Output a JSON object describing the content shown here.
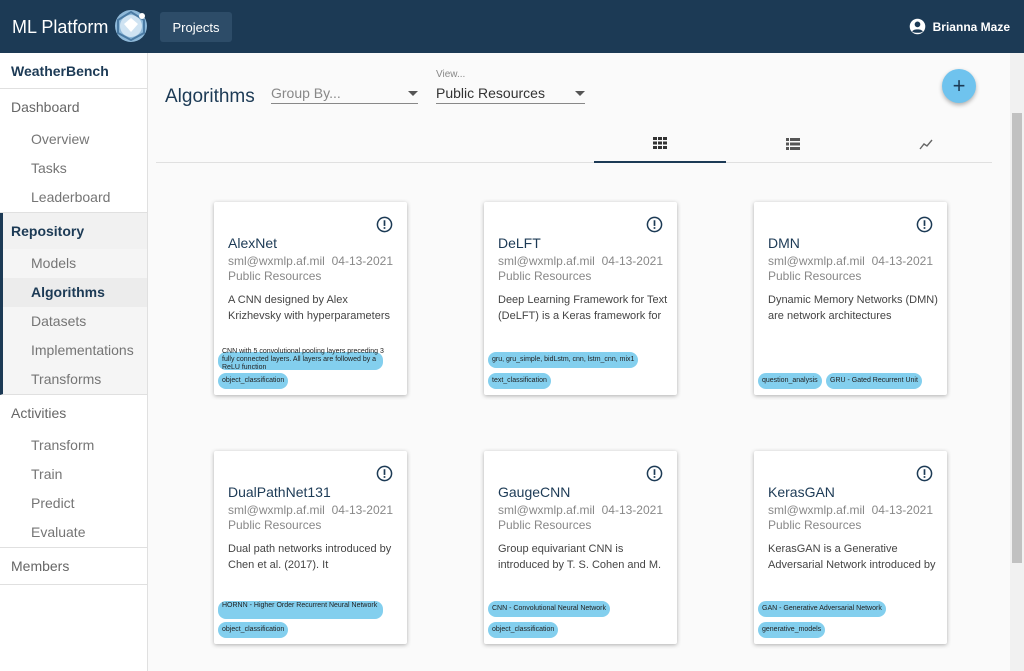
{
  "header": {
    "brand": "ML Platform",
    "projects_label": "Projects",
    "user_name": "Brianna Maze"
  },
  "sidebar": {
    "project": "WeatherBench",
    "dashboard": {
      "label": "Dashboard",
      "items": [
        "Overview",
        "Tasks",
        "Leaderboard"
      ]
    },
    "repository": {
      "label": "Repository",
      "items": [
        "Models",
        "Algorithms",
        "Datasets",
        "Implementations",
        "Transforms"
      ],
      "active": "Algorithms"
    },
    "activities": {
      "label": "Activities",
      "items": [
        "Transform",
        "Train",
        "Predict",
        "Evaluate"
      ]
    },
    "members": "Members"
  },
  "main": {
    "title": "Algorithms",
    "group_by_placeholder": "Group By...",
    "view_label": "View...",
    "view_value": "Public Resources",
    "add_symbol": "+",
    "active_tab": "grid"
  },
  "colors": {
    "primary": "#1c3a55",
    "accent": "#6fc3ee",
    "tag": "#83cfee"
  },
  "cards": [
    {
      "name": "AlexNet",
      "email": "sml@wxmlp.af.mil",
      "date": "04-13-2021",
      "visibility": "Public Resources",
      "description": "A CNN designed by Alex Krizhevsky with hyperparameters",
      "overflow_text": "CNN with 5 convolutional pooling layers preceding 3 fully connected layers. All layers are followed by a ReLU function",
      "tags": [
        "object_classification"
      ]
    },
    {
      "name": "DeLFT",
      "email": "sml@wxmlp.af.mil",
      "date": "04-13-2021",
      "visibility": "Public Resources",
      "description": "Deep Learning Framework for Text (DeLFT) is a Keras framework for",
      "tags": [
        "gru, gru_simple, bidLstm, cnn, lstm_cnn, mix1",
        "text_classification"
      ]
    },
    {
      "name": "DMN",
      "email": "sml@wxmlp.af.mil",
      "date": "04-13-2021",
      "visibility": "Public Resources",
      "description": "Dynamic Memory Networks (DMN) are network architectures",
      "tags": [
        "question_analysis",
        "GRU - Gated Recurrent Unit"
      ]
    },
    {
      "name": "DualPathNet131",
      "email": "sml@wxmlp.af.mil",
      "date": "04-13-2021",
      "visibility": "Public Resources",
      "description": "Dual path networks introduced by Chen et al. (2017). It",
      "tags": [
        "HORNN - Higher Order Recurrent Neural Network",
        "object_classification"
      ]
    },
    {
      "name": "GaugeCNN",
      "email": "sml@wxmlp.af.mil",
      "date": "04-13-2021",
      "visibility": "Public Resources",
      "description": "Group equivariant CNN is introduced by T. S. Cohen and M.",
      "tags": [
        "CNN - Convolutional Neural Network",
        "object_classification"
      ]
    },
    {
      "name": "KerasGAN",
      "email": "sml@wxmlp.af.mil",
      "date": "04-13-2021",
      "visibility": "Public Resources",
      "description": "KerasGAN is a Generative Adversarial Network introduced by",
      "tags": [
        "GAN - Generative Adversarial Network",
        "generative_models"
      ]
    }
  ]
}
